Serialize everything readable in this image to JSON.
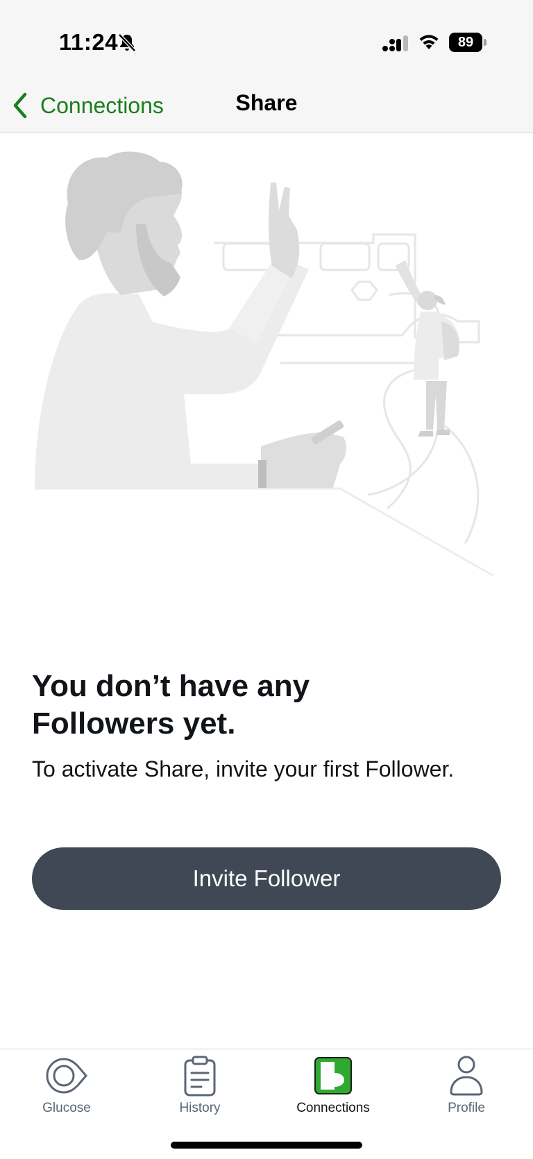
{
  "status_bar": {
    "time": "11:24",
    "battery_level": "89",
    "icons": [
      "bell-slash-icon",
      "cellular-signal-icon",
      "wifi-icon",
      "battery-icon"
    ]
  },
  "nav": {
    "back_label": "Connections",
    "title": "Share"
  },
  "empty_state": {
    "heading_line1": "You don’t have any",
    "heading_line2": "Followers yet.",
    "body": "To activate Share, invite your first Follower.",
    "button_label": "Invite Follower"
  },
  "tabs": [
    {
      "label": "Glucose",
      "icon": "glucose-eye-icon",
      "active": false
    },
    {
      "label": "History",
      "icon": "clipboard-icon",
      "active": false
    },
    {
      "label": "Connections",
      "icon": "connections-icon",
      "active": true
    },
    {
      "label": "Profile",
      "icon": "person-icon",
      "active": false
    }
  ],
  "colors": {
    "accent_green": "#1a7f1d",
    "active_tab_green": "#2eaa2f",
    "button_dark": "#3f4854",
    "bar_background": "#f6f6f6"
  }
}
